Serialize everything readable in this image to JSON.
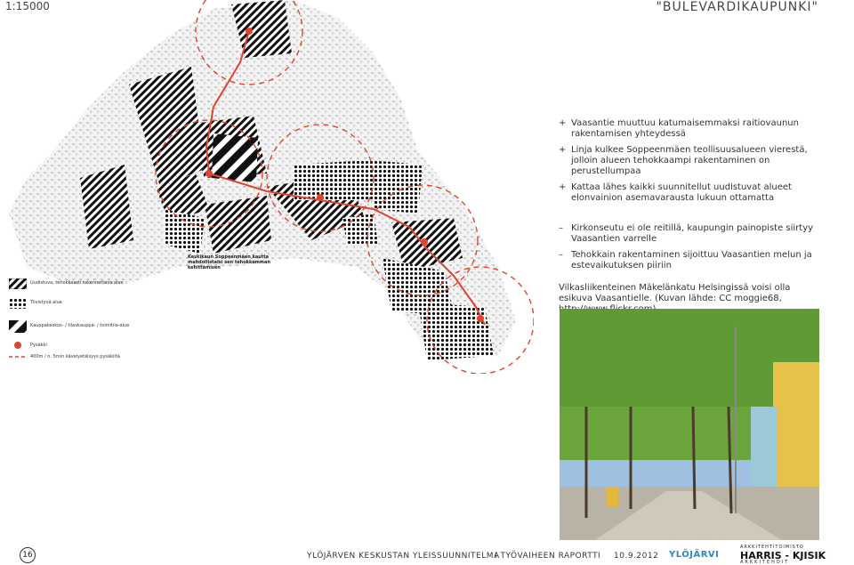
{
  "header": {
    "scale": "1:15000",
    "title": "\"BULEVARDIKAUPUNKI\""
  },
  "map": {
    "callout": "Keskikaun Soppeenmäen kautta mahdollistaisi sen tehokkamman kehittämisen"
  },
  "legend": [
    {
      "label": "Uudistuva, tehokkaasti rakennettava alue",
      "icon": "diagonal-hatch-swatch"
    },
    {
      "label": "Tiivistyvä alue",
      "icon": "dot-pattern-swatch"
    },
    {
      "label": "Kauppakeskus- / tilavkauppa- / toimitila-alue",
      "icon": "thick-hatch-swatch"
    },
    {
      "label": "Pysäkki",
      "icon": "red-dot-swatch"
    },
    {
      "label": "400m / n. 5min kävelyetäisyys pysäkiltä",
      "icon": "red-dashed-line-swatch"
    }
  ],
  "bullets": {
    "plus": [
      "Vaasantie muuttuu katumaisemmaksi raitiovaunun rakentamisen yhteydessä",
      "Linja kulkee Soppeenmäen teollisuusalueen vierestä, jolloin alueen tehokkaampi rakentaminen on perustellumpaa",
      "Kattaa lähes kaikki suunnitellut uudistuvat alueet elonvainion asemavarausta lukuun ottamatta"
    ],
    "minus": [
      "Kirkonseutu ei ole reitillä, kaupungin painopiste siirtyy Vaasantien varrelle",
      "Tehokkain rakentaminen sijoittuu Vaasantien melun ja estevaikutuksen piiriin"
    ],
    "plus_mark": "+",
    "minus_mark": "–"
  },
  "caption": "Vilkasliikenteinen Mäkelänkatu Helsingissä voisi olla esikuva Vaasantielle. (Kuvan lähde: CC moggie68, http://www.flickr.com)",
  "footer": {
    "page": "16",
    "plan": "YLÖJÄRVEN KESKUSTAN YLEISSUUNNITELMA",
    "report": "I TYÖVAIHEEN RAPORTTI",
    "date": "10.9.2012",
    "city_logo": "YLÖJÄRVI",
    "firm_top": "ARKKITEHTITOIMISTO",
    "firm_name": "HARRIS - KJISIK",
    "firm_bottom": "ARKKITEHDIT"
  },
  "colors": {
    "accent_red": "#e0442f",
    "ink": "#333333"
  }
}
